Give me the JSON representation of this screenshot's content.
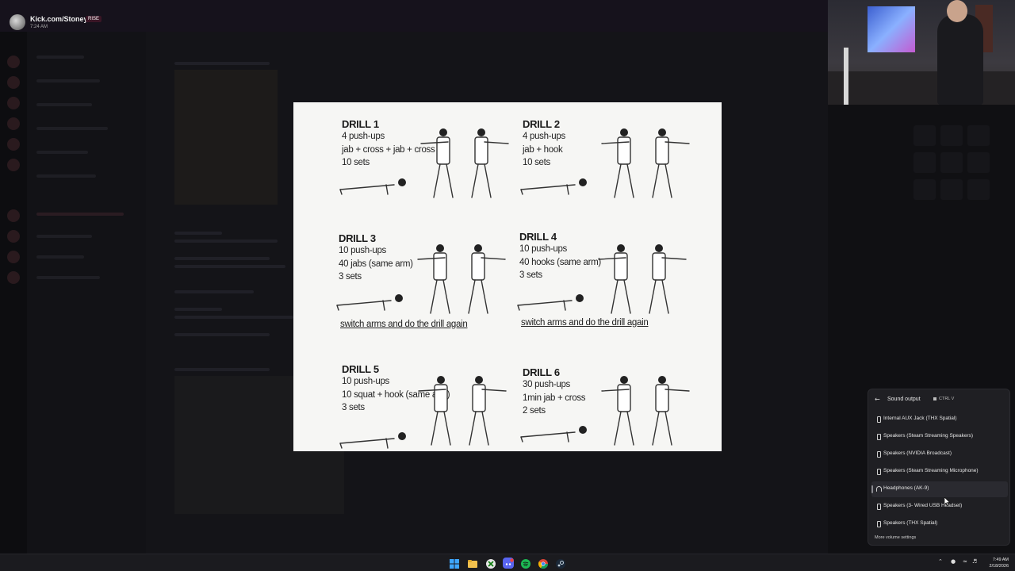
{
  "header": {
    "channel_title": "Kick.com/Stoney...",
    "badge": "RISE",
    "time": "7:24 AM"
  },
  "drills": [
    {
      "title": "DRILL 1",
      "lines": [
        "4 push-ups",
        "jab + cross + jab + cross",
        "10 sets"
      ],
      "note": ""
    },
    {
      "title": "DRILL 2",
      "lines": [
        "4 push-ups",
        "jab + hook",
        "10 sets"
      ],
      "note": ""
    },
    {
      "title": "DRILL 3",
      "lines": [
        "10 push-ups",
        "40 jabs (same arm)",
        "3 sets"
      ],
      "note": "switch arms and do the drill again"
    },
    {
      "title": "DRILL 4",
      "lines": [
        "10 push-ups",
        "40 hooks (same arm)",
        "3 sets"
      ],
      "note": "switch arms and do the drill again"
    },
    {
      "title": "DRILL 5",
      "lines": [
        "10 push-ups",
        "10 squat + hook (same arm)",
        "3 sets"
      ],
      "note": ""
    },
    {
      "title": "DRILL 6",
      "lines": [
        "30 push-ups",
        "1min jab + cross",
        "2 sets"
      ],
      "note": ""
    }
  ],
  "sound_output": {
    "title": "Sound output",
    "hotkey": "CTRL  V",
    "devices": [
      {
        "label": "Internal AUX Jack (THX Spatial)",
        "icon": "speaker-icon",
        "selected": false
      },
      {
        "label": "Speakers (Steam Streaming Speakers)",
        "icon": "speaker-icon",
        "selected": false
      },
      {
        "label": "Speakers (NVIDIA Broadcast)",
        "icon": "speaker-icon",
        "selected": false
      },
      {
        "label": "Speakers (Steam Streaming Microphone)",
        "icon": "speaker-icon",
        "selected": false
      },
      {
        "label": "Headphones (AK-9)",
        "icon": "headphones-icon",
        "selected": true
      },
      {
        "label": "Speakers (3- Wired USB Headset)",
        "icon": "speaker-icon",
        "selected": false
      },
      {
        "label": "Speakers (THX Spatial)",
        "icon": "speaker-icon",
        "selected": false
      }
    ],
    "more_link": "More volume settings"
  },
  "taskbar": {
    "apps": [
      "windows-start-icon",
      "file-explorer-icon",
      "xbox-icon",
      "discord-icon",
      "spotify-icon",
      "chrome-icon",
      "steam-icon"
    ],
    "clock_time": "7:49 AM",
    "clock_date": "2/18/2026"
  },
  "colors": {
    "panel_bg": "#1f1f23",
    "taskbar_bg": "#1b1b1f",
    "drill_card_bg": "#f6f6f4",
    "spotify_green": "#1db954",
    "discord_purple": "#5865f2"
  }
}
